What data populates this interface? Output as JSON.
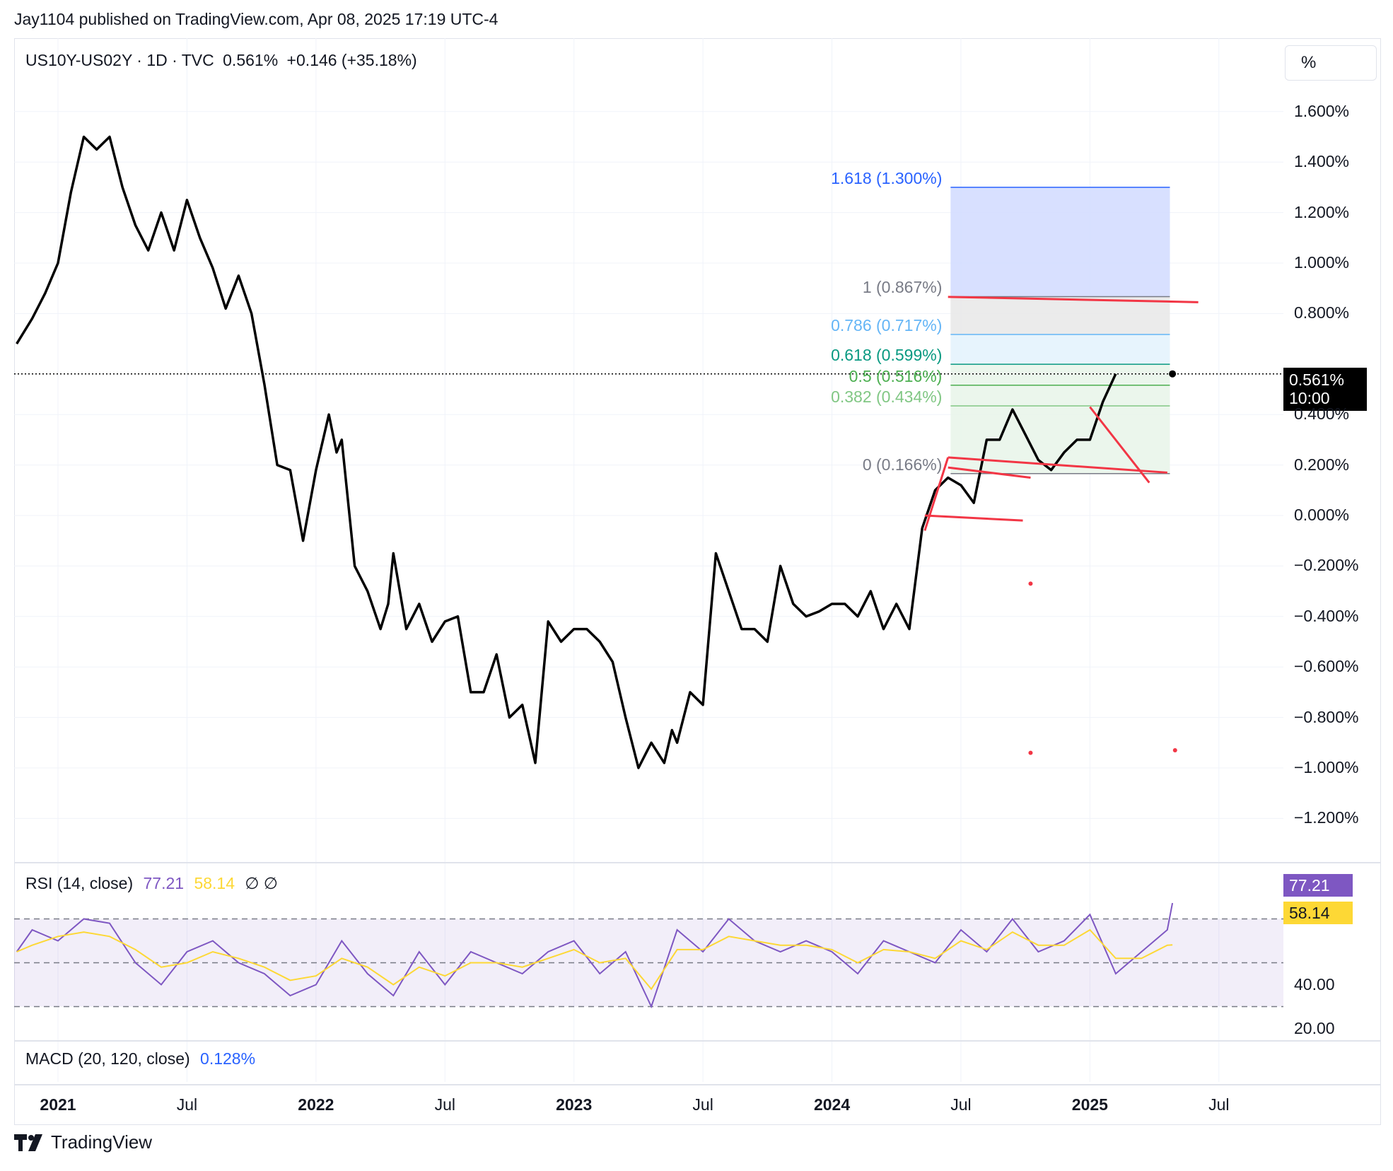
{
  "header": {
    "published": "Jay1104 published on TradingView.com, Apr 08, 2025 17:19 UTC-4"
  },
  "legend": {
    "symbol": "US10Y-US02Y · 1D · TVC",
    "last": "0.561%",
    "change": "+0.146 (+35.18%)"
  },
  "scale_button": "%",
  "price_badge": {
    "value": "0.561%",
    "time": "10:00"
  },
  "rsi": {
    "label": "RSI (14, close)",
    "value": "77.21",
    "ma": "58.14",
    "flags": "∅ ∅",
    "color": "#7e57c2",
    "ma_color": "#fdd835",
    "axis_labels": [
      "40.00",
      "20.00"
    ]
  },
  "macd": {
    "label": "MACD (20, 120, close)",
    "value": "0.128%",
    "color": "#2962ff"
  },
  "footer": {
    "brand": "TradingView"
  },
  "colors": {
    "line": "#000000",
    "fib_red": "#f23645",
    "fib_blue": "#2962ff",
    "grid": "#f0f3fa"
  },
  "chart_data": {
    "type": "line",
    "title": "US10Y-US02Y",
    "ylabel": "%",
    "ylim": [
      -1.3,
      1.65
    ],
    "y_ticks": [
      "1.600%",
      "1.400%",
      "1.200%",
      "1.000%",
      "0.800%",
      "0.400%",
      "0.200%",
      "0.000%",
      "−0.200%",
      "−0.400%",
      "−0.600%",
      "−0.800%",
      "−1.000%",
      "−1.200%"
    ],
    "y_tick_values": [
      1.6,
      1.4,
      1.2,
      1.0,
      0.8,
      0.4,
      0.2,
      0.0,
      -0.2,
      -0.4,
      -0.6,
      -0.8,
      -1.0,
      -1.2
    ],
    "x_labels": [
      {
        "t": 0.0,
        "label": "2021",
        "major": true
      },
      {
        "t": 0.5,
        "label": "Jul",
        "major": false
      },
      {
        "t": 1.0,
        "label": "2022",
        "major": true
      },
      {
        "t": 1.5,
        "label": "Jul",
        "major": false
      },
      {
        "t": 2.0,
        "label": "2023",
        "major": true
      },
      {
        "t": 2.5,
        "label": "Jul",
        "major": false
      },
      {
        "t": 3.0,
        "label": "2024",
        "major": true
      },
      {
        "t": 3.5,
        "label": "Jul",
        "major": false
      },
      {
        "t": 4.0,
        "label": "2025",
        "major": true
      },
      {
        "t": 4.5,
        "label": "Jul",
        "major": false
      }
    ],
    "xlim": [
      -0.17,
      4.75
    ],
    "series": [
      {
        "name": "US10Y-US02Y",
        "t": [
          -0.16,
          -0.1,
          -0.05,
          0.0,
          0.05,
          0.1,
          0.15,
          0.2,
          0.25,
          0.3,
          0.35,
          0.4,
          0.45,
          0.5,
          0.55,
          0.6,
          0.65,
          0.7,
          0.75,
          0.8,
          0.85,
          0.9,
          0.95,
          1.0,
          1.05,
          1.08,
          1.1,
          1.15,
          1.2,
          1.25,
          1.28,
          1.3,
          1.35,
          1.4,
          1.45,
          1.5,
          1.55,
          1.6,
          1.65,
          1.7,
          1.75,
          1.8,
          1.85,
          1.9,
          1.95,
          2.0,
          2.05,
          2.1,
          2.15,
          2.2,
          2.25,
          2.3,
          2.35,
          2.38,
          2.4,
          2.45,
          2.5,
          2.55,
          2.6,
          2.65,
          2.7,
          2.75,
          2.8,
          2.85,
          2.9,
          2.95,
          3.0,
          3.05,
          3.1,
          3.15,
          3.2,
          3.25,
          3.3,
          3.35,
          3.4,
          3.45,
          3.5,
          3.55,
          3.6,
          3.65,
          3.7,
          3.75,
          3.8,
          3.85,
          3.9,
          3.95,
          4.0,
          4.05,
          4.1,
          4.15,
          4.2,
          4.25,
          4.3,
          4.32
        ],
        "values": [
          0.68,
          0.78,
          0.88,
          1.0,
          1.28,
          1.5,
          1.45,
          1.5,
          1.3,
          1.15,
          1.05,
          1.2,
          1.05,
          1.25,
          1.1,
          0.98,
          0.82,
          0.95,
          0.8,
          0.52,
          0.2,
          0.18,
          -0.1,
          0.18,
          0.4,
          0.25,
          0.3,
          -0.2,
          -0.3,
          -0.45,
          -0.35,
          -0.15,
          -0.45,
          -0.35,
          -0.5,
          -0.42,
          -0.4,
          -0.7,
          -0.7,
          -0.55,
          -0.8,
          -0.75,
          -0.98,
          -0.42,
          -0.5,
          -0.45,
          -0.45,
          -0.5,
          -0.58,
          -0.8,
          -1.0,
          -0.9,
          -0.98,
          -0.85,
          -0.9,
          -0.7,
          -0.75,
          -0.15,
          -0.3,
          -0.45,
          -0.45,
          -0.5,
          -0.2,
          -0.35,
          -0.4,
          -0.38,
          -0.35,
          -0.35,
          -0.4,
          -0.3,
          -0.45,
          -0.35,
          -0.45,
          -0.05,
          0.1,
          0.15,
          0.12,
          0.05,
          0.3,
          0.3,
          0.42,
          0.32,
          0.22,
          0.18,
          0.25,
          0.3,
          0.3,
          0.45,
          0.561
        ]
      }
    ],
    "fibonacci": [
      {
        "ratio": "1.618 (1.300%)",
        "value": 1.3,
        "color": "#2962ff"
      },
      {
        "ratio": "1 (0.867%)",
        "value": 0.867,
        "color": "#787b86"
      },
      {
        "ratio": "0.786 (0.717%)",
        "value": 0.717,
        "color": "#64b5f6"
      },
      {
        "ratio": "0.618 (0.599%)",
        "value": 0.599,
        "color": "#089981"
      },
      {
        "ratio": "0.5 (0.516%)",
        "value": 0.516,
        "color": "#4caf50"
      },
      {
        "ratio": "0.382 (0.434%)",
        "value": 0.434,
        "color": "#81c784"
      },
      {
        "ratio": "0 (0.166%)",
        "value": 0.166,
        "color": "#787b86"
      }
    ],
    "rsi_series": {
      "ylim": [
        15,
        95
      ],
      "bands": [
        70,
        50,
        30
      ],
      "t": [
        -0.16,
        -0.1,
        0.0,
        0.1,
        0.2,
        0.3,
        0.4,
        0.5,
        0.6,
        0.7,
        0.8,
        0.9,
        1.0,
        1.1,
        1.2,
        1.3,
        1.4,
        1.5,
        1.6,
        1.7,
        1.8,
        1.9,
        2.0,
        2.1,
        2.2,
        2.3,
        2.4,
        2.5,
        2.6,
        2.7,
        2.8,
        2.9,
        3.0,
        3.1,
        3.2,
        3.3,
        3.4,
        3.5,
        3.6,
        3.7,
        3.8,
        3.9,
        4.0,
        4.1,
        4.2,
        4.3,
        4.32
      ],
      "values": [
        55,
        65,
        60,
        70,
        68,
        50,
        40,
        55,
        60,
        50,
        45,
        35,
        40,
        60,
        45,
        35,
        55,
        40,
        55,
        50,
        45,
        55,
        60,
        45,
        55,
        30,
        65,
        55,
        70,
        60,
        55,
        60,
        55,
        45,
        60,
        55,
        50,
        65,
        55,
        70,
        55,
        60,
        72,
        45,
        55,
        65,
        77.21
      ],
      "ma": [
        55,
        58,
        62,
        64,
        62,
        56,
        48,
        50,
        55,
        52,
        48,
        42,
        44,
        52,
        48,
        40,
        48,
        44,
        50,
        50,
        48,
        52,
        56,
        50,
        52,
        38,
        56,
        56,
        62,
        60,
        58,
        58,
        56,
        50,
        56,
        55,
        52,
        60,
        56,
        64,
        58,
        58,
        65,
        52,
        52,
        58,
        58.14
      ]
    }
  }
}
